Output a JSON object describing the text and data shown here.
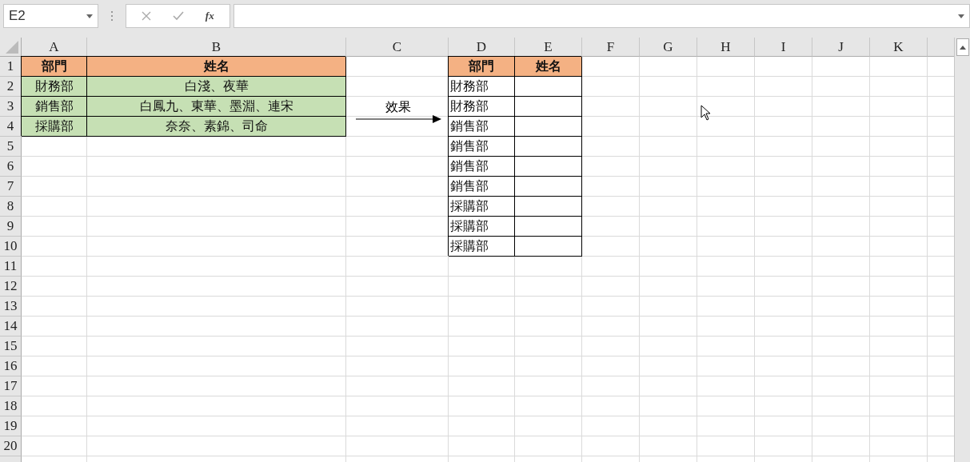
{
  "name_box": {
    "value": "E2"
  },
  "formula_bar": {
    "fx_label": "fx"
  },
  "sheet": {
    "columns": [
      "A",
      "B",
      "C",
      "D",
      "E",
      "F",
      "G",
      "H",
      "I",
      "J",
      "K"
    ],
    "rows": [
      {
        "number": "1",
        "cells": [
          {
            "kind": "header",
            "text": "部門"
          },
          {
            "kind": "header",
            "text": "姓名"
          },
          {
            "kind": "blank"
          },
          {
            "kind": "header",
            "text": "部門"
          },
          {
            "kind": "header",
            "text": "姓名"
          }
        ]
      },
      {
        "number": "2",
        "cells": [
          {
            "kind": "data",
            "text": "財務部"
          },
          {
            "kind": "data",
            "text": "白淺、夜華"
          },
          {
            "kind": "blank"
          },
          {
            "kind": "boxed",
            "text": "財務部"
          },
          {
            "kind": "boxed"
          }
        ]
      },
      {
        "number": "3",
        "cells": [
          {
            "kind": "data",
            "text": "銷售部"
          },
          {
            "kind": "data",
            "text": "白鳳九、東華、墨淵、連宋"
          },
          {
            "kind": "blank"
          },
          {
            "kind": "boxed",
            "text": "財務部"
          },
          {
            "kind": "boxed"
          }
        ]
      },
      {
        "number": "4",
        "cells": [
          {
            "kind": "data",
            "text": "採購部"
          },
          {
            "kind": "data",
            "text": "奈奈、素錦、司命"
          },
          {
            "kind": "blank"
          },
          {
            "kind": "boxed",
            "text": "銷售部"
          },
          {
            "kind": "boxed"
          }
        ]
      },
      {
        "number": "5",
        "cells": [
          {
            "kind": "blank"
          },
          {
            "kind": "blank"
          },
          {
            "kind": "blank"
          },
          {
            "kind": "boxed",
            "text": "銷售部"
          },
          {
            "kind": "boxed"
          }
        ]
      },
      {
        "number": "6",
        "cells": [
          {
            "kind": "blank"
          },
          {
            "kind": "blank"
          },
          {
            "kind": "blank"
          },
          {
            "kind": "boxed",
            "text": "銷售部"
          },
          {
            "kind": "boxed"
          }
        ]
      },
      {
        "number": "7",
        "cells": [
          {
            "kind": "blank"
          },
          {
            "kind": "blank"
          },
          {
            "kind": "blank"
          },
          {
            "kind": "boxed",
            "text": "銷售部"
          },
          {
            "kind": "boxed"
          }
        ]
      },
      {
        "number": "8",
        "cells": [
          {
            "kind": "blank"
          },
          {
            "kind": "blank"
          },
          {
            "kind": "blank"
          },
          {
            "kind": "boxed",
            "text": "採購部"
          },
          {
            "kind": "boxed"
          }
        ]
      },
      {
        "number": "9",
        "cells": [
          {
            "kind": "blank"
          },
          {
            "kind": "blank"
          },
          {
            "kind": "blank"
          },
          {
            "kind": "boxed",
            "text": "採購部"
          },
          {
            "kind": "boxed"
          }
        ]
      },
      {
        "number": "10",
        "cells": [
          {
            "kind": "blank"
          },
          {
            "kind": "blank"
          },
          {
            "kind": "blank"
          },
          {
            "kind": "boxed",
            "text": "採購部"
          },
          {
            "kind": "boxed"
          }
        ]
      },
      {
        "number": "11",
        "cells": []
      },
      {
        "number": "12",
        "cells": []
      },
      {
        "number": "13",
        "cells": []
      },
      {
        "number": "14",
        "cells": []
      },
      {
        "number": "15",
        "cells": []
      },
      {
        "number": "16",
        "cells": []
      },
      {
        "number": "17",
        "cells": []
      },
      {
        "number": "18",
        "cells": []
      },
      {
        "number": "19",
        "cells": []
      },
      {
        "number": "20",
        "cells": []
      }
    ],
    "annotation": {
      "label": "效果"
    }
  }
}
